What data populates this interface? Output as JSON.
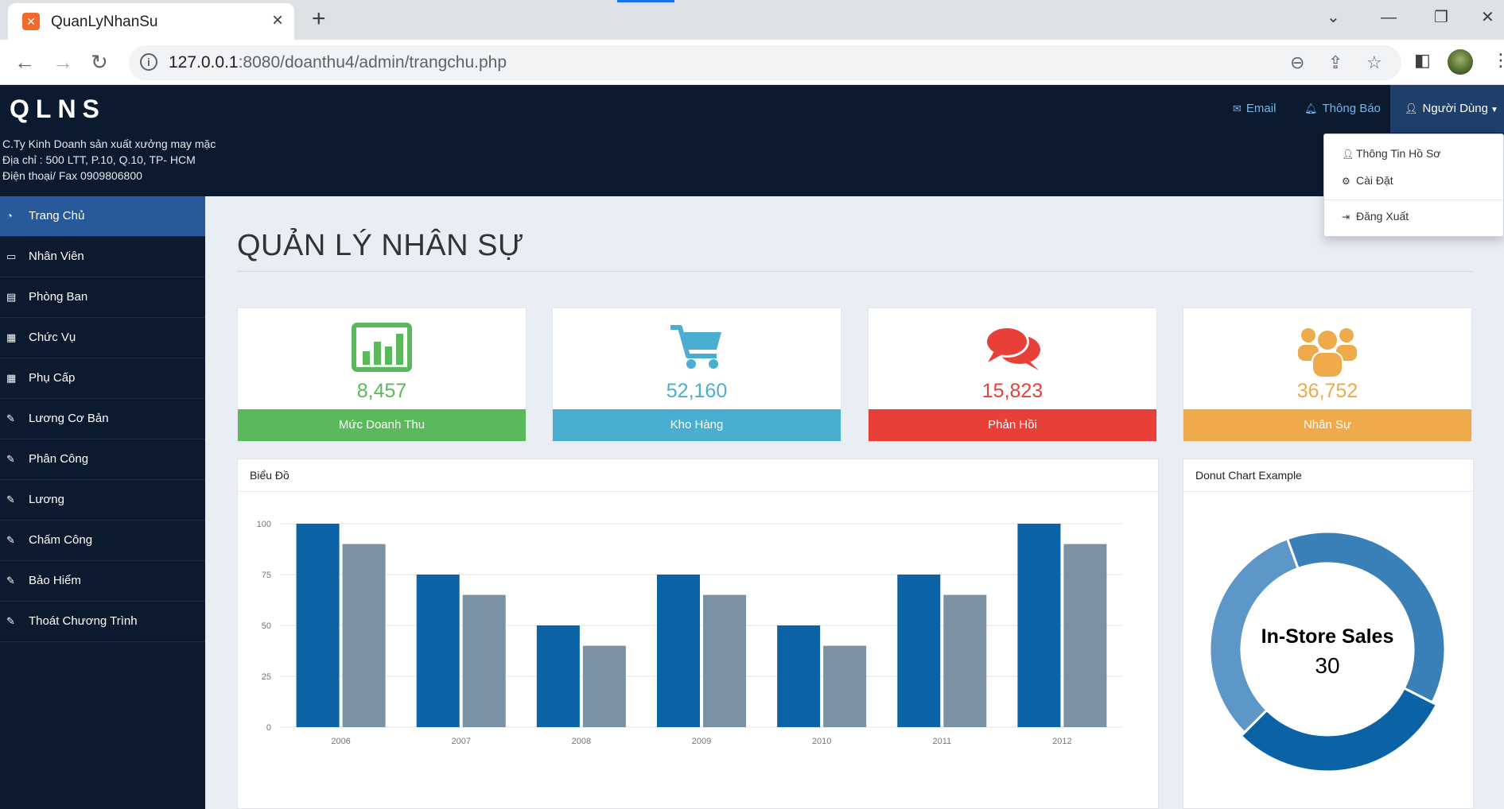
{
  "browser": {
    "tab_title": "QuanLyNhanSu",
    "url_host": "127.0.0.1",
    "url_path": ":8080/doanthu4/admin/trangchu.php"
  },
  "header": {
    "brand": "QLNS",
    "company_lines": [
      "C.Ty Kinh Doanh sản xuất xưởng may mặc",
      "Địa chỉ : 500 LTT, P.10, Q.10, TP- HCM",
      "Điện thoại/ Fax 0909806800"
    ],
    "nav": {
      "email": "Email",
      "notifications": "Thông Báo",
      "user": "Người Dùng"
    },
    "user_menu": [
      "Thông Tin Hồ Sơ",
      "Cài Đặt",
      "Đăng Xuất"
    ]
  },
  "sidebar": {
    "items": [
      {
        "label": "Trang Chủ",
        "icon": "dashboard-icon"
      },
      {
        "label": "Nhân Viên",
        "icon": "monitor-icon"
      },
      {
        "label": "Phòng Ban",
        "icon": "bar-chart-icon"
      },
      {
        "label": "Chức Vụ",
        "icon": "qrcode-icon"
      },
      {
        "label": "Phụ Cấp",
        "icon": "table-icon"
      },
      {
        "label": "Lương Cơ Bản",
        "icon": "edit-icon"
      },
      {
        "label": "Phân Công",
        "icon": "edit-icon"
      },
      {
        "label": "Lương",
        "icon": "edit-icon"
      },
      {
        "label": "Chấm Công",
        "icon": "edit-icon"
      },
      {
        "label": "Bảo Hiểm",
        "icon": "edit-icon"
      },
      {
        "label": "Thoát Chương Trình",
        "icon": "edit-icon"
      }
    ]
  },
  "main": {
    "title": "QUẢN LÝ NHÂN SỰ",
    "stats": [
      {
        "value": "8,457",
        "label": "Mức Doanh Thu",
        "color": "#5cb85c",
        "icon": "bar-chart-icon"
      },
      {
        "value": "52,160",
        "label": "Kho Hàng",
        "color": "#4aaed0",
        "icon": "shopping-cart-icon"
      },
      {
        "value": "15,823",
        "label": "Phản Hồi",
        "color": "#e84039",
        "icon": "comments-icon"
      },
      {
        "value": "36,752",
        "label": "Nhân Sự",
        "color": "#eeaa4b",
        "icon": "users-icon"
      }
    ],
    "bar_panel_title": "Biểu Đồ",
    "donut_panel_title": "Donut Chart Example"
  },
  "chart_data": [
    {
      "type": "bar",
      "categories": [
        "2006",
        "2007",
        "2008",
        "2009",
        "2010",
        "2011",
        "2012"
      ],
      "series": [
        {
          "values": [
            100,
            75,
            50,
            75,
            50,
            75,
            100
          ],
          "color": "#0b62a4"
        },
        {
          "values": [
            90,
            65,
            40,
            65,
            40,
            65,
            90
          ],
          "color": "#7a92a3"
        }
      ],
      "ylim": [
        0,
        100
      ],
      "yticks": [
        0,
        25,
        50,
        75,
        100
      ],
      "grid": true
    },
    {
      "type": "pie",
      "donut": true,
      "center_label": "In-Store Sales",
      "center_value": "30",
      "slices": [
        {
          "label": "In-Store Sales",
          "value": 30,
          "color": "#0b62a4"
        },
        {
          "value": 32,
          "color": "#5c97c8"
        },
        {
          "value": 38,
          "color": "#3980b8"
        }
      ]
    }
  ]
}
